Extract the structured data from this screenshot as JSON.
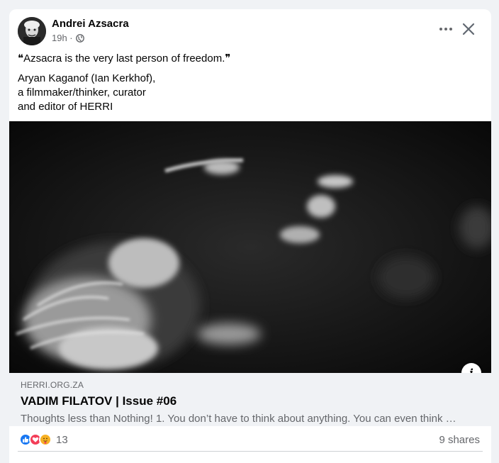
{
  "post": {
    "author": "Andrei Azsacra",
    "time": "19h ·",
    "audience_icon": "globe-icon",
    "quote": "❝Azsacra is the very last person of freedom.❞",
    "attribution": [
      "Aryan Kaganof (Ian Kerkhof),",
      "a filmmaker/thinker, curator",
      "and editor of HERRI"
    ]
  },
  "link": {
    "domain": "HERRI.ORG.ZA",
    "title": "VADIM FILATOV | Issue #06",
    "description": "Thoughts less than Nothing! 1. You don’t have to think about anything. You can even think …"
  },
  "stats": {
    "reaction_icons": [
      "like-icon",
      "love-icon",
      "care-icon"
    ],
    "reaction_count": "13",
    "shares": "9 shares"
  },
  "colors": {
    "like": "#1877f2",
    "love": "#f33e58",
    "care": "#f7b125",
    "secondary_text": "#65676b",
    "link_bg": "#f0f2f5"
  }
}
